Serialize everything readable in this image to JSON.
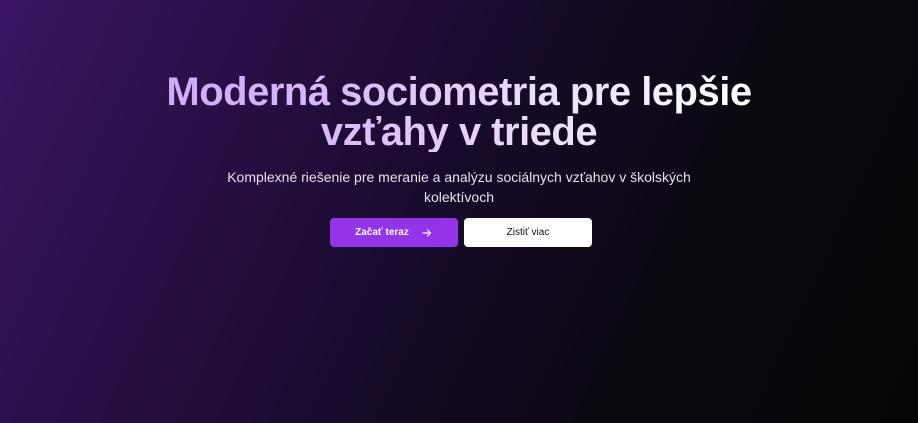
{
  "hero": {
    "title_line1": "Moderná sociometria pre lepšie",
    "title_line2": "vzťahy v triede",
    "subtitle": "Komplexné riešenie pre meranie a analýzu sociálnych vzťahov v školských kolektívoch",
    "primary_button": {
      "label": "Začať teraz",
      "icon": "arrow-right-icon",
      "color": "#9333ea"
    },
    "secondary_button": {
      "label": "Zistiť viac",
      "color": "#ffffff"
    }
  },
  "theme": {
    "background_start": "#3b1463",
    "background_end": "#050505",
    "title_gradient_start": "#c79cf5",
    "title_gradient_end": "#ffffff"
  }
}
